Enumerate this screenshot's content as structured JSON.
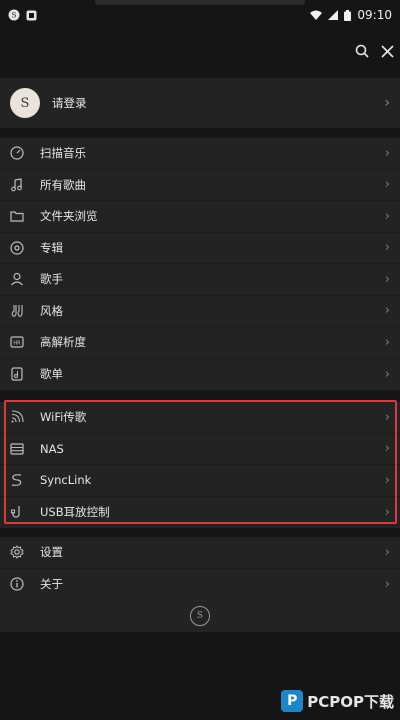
{
  "status_bar": {
    "time": "09:10"
  },
  "login": {
    "label": "请登录"
  },
  "menu": [
    {
      "label": "扫描音乐",
      "icon": "scan-icon"
    },
    {
      "label": "所有歌曲",
      "icon": "music-note-icon"
    },
    {
      "label": "文件夹浏览",
      "icon": "folder-icon"
    },
    {
      "label": "专辑",
      "icon": "album-icon"
    },
    {
      "label": "歌手",
      "icon": "artist-icon"
    },
    {
      "label": "风格",
      "icon": "genre-icon"
    },
    {
      "label": "高解析度",
      "icon": "hires-icon"
    },
    {
      "label": "歌单",
      "icon": "playlist-icon"
    }
  ],
  "network_menu": [
    {
      "label": "WiFi传歌",
      "icon": "wifi-icon"
    },
    {
      "label": "NAS",
      "icon": "nas-icon"
    },
    {
      "label": "SyncLink",
      "icon": "synclink-icon"
    },
    {
      "label": "USB耳放控制",
      "icon": "usb-amp-icon"
    }
  ],
  "settings_menu": [
    {
      "label": "设置",
      "icon": "gear-icon"
    },
    {
      "label": "关于",
      "icon": "info-icon"
    }
  ],
  "watermark": {
    "brand": "PCPOP下载",
    "badge": "P"
  },
  "colors": {
    "background": "#151515",
    "panel": "#232323",
    "highlight": "#d9393f"
  }
}
